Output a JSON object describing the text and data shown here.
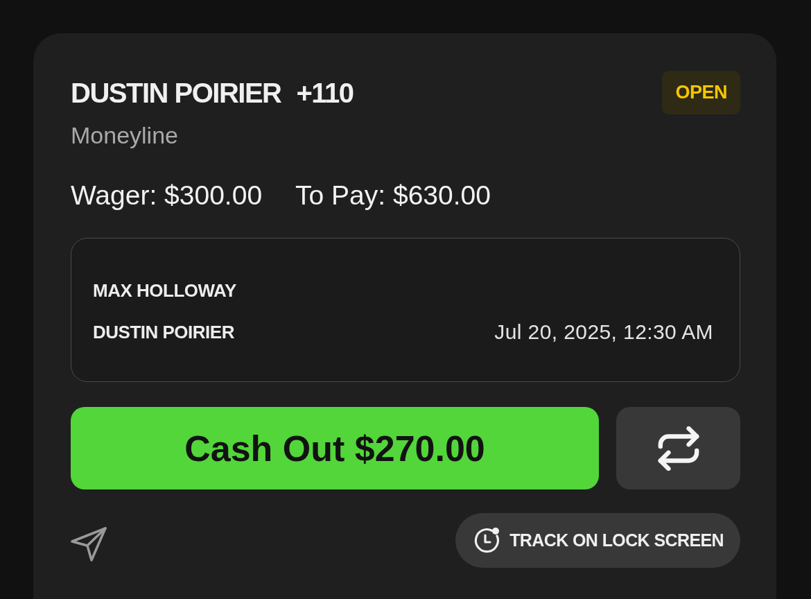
{
  "bet": {
    "selection": "DUSTIN POIRIER",
    "odds": "+110",
    "status": {
      "label": "OPEN",
      "kind": "open"
    },
    "market": "Moneyline",
    "wager": "Wager: $300.00",
    "to_pay": "To Pay: $630.00"
  },
  "event": {
    "competitors": [
      "MAX HOLLOWAY",
      "DUSTIN POIRIER"
    ],
    "start_time": "Jul 20, 2025, 12:30 AM"
  },
  "actions": {
    "cash_out": "Cash Out $270.00",
    "track": "TRACK ON LOCK SCREEN"
  }
}
